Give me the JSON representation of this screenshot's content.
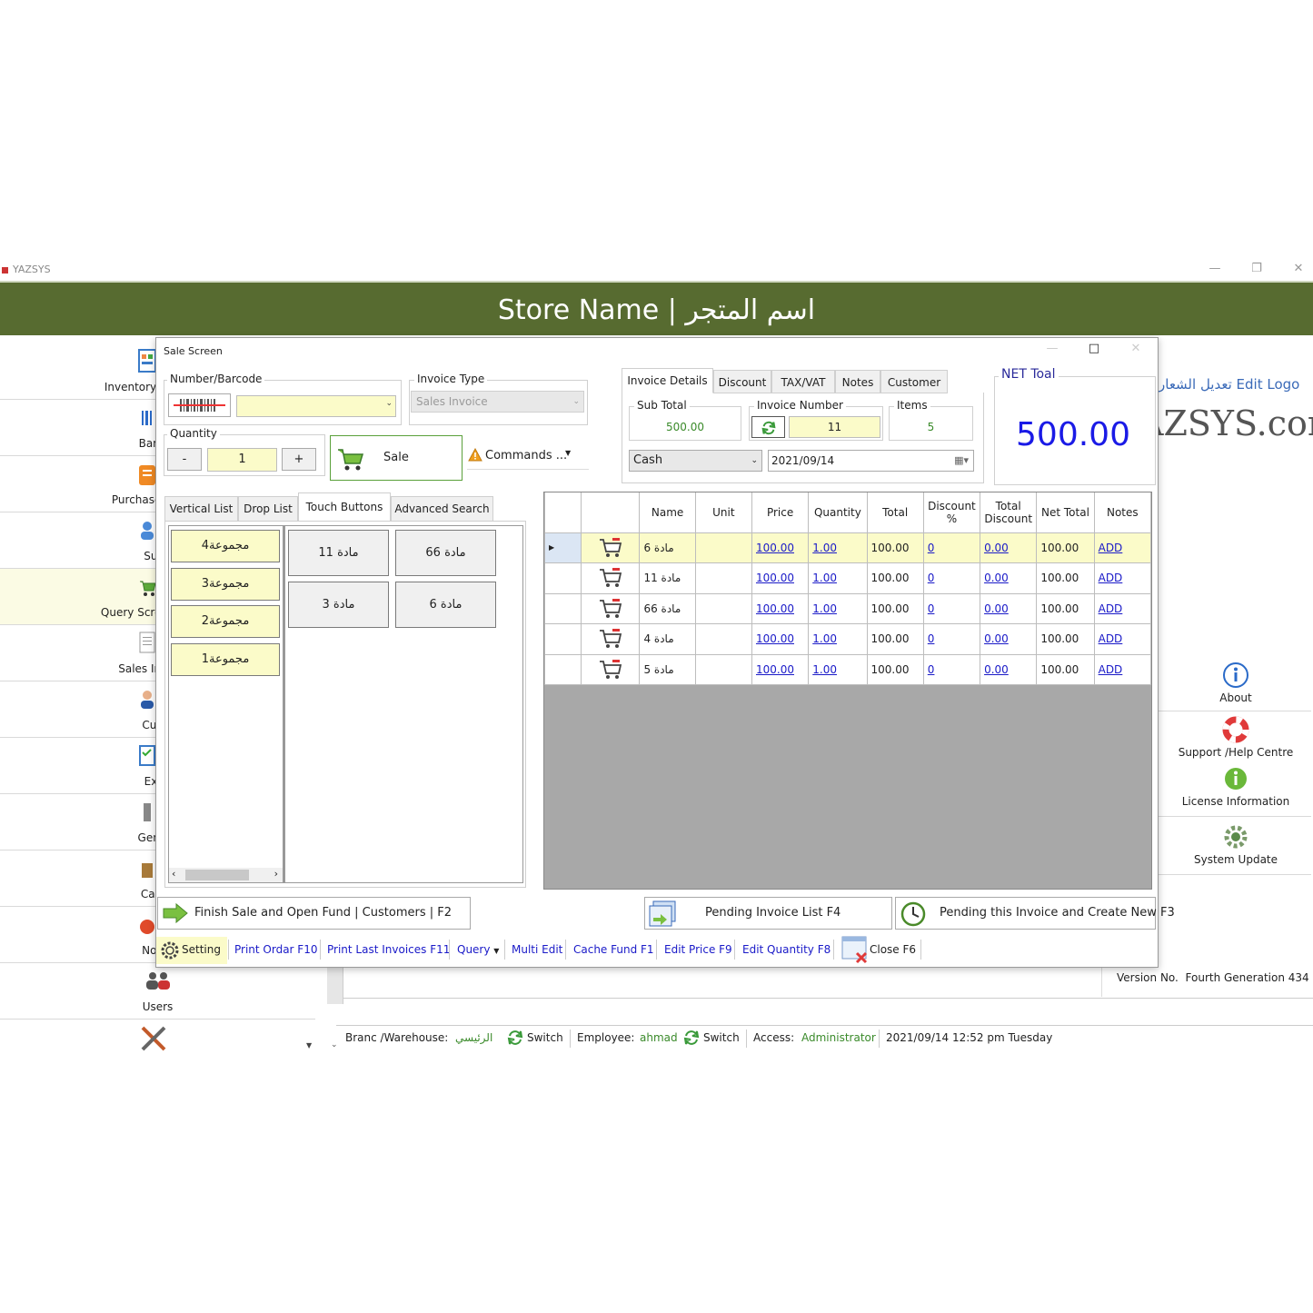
{
  "app": {
    "title": "YAZSYS",
    "banner": "Store Name | اسم المتجر"
  },
  "sidebar": {
    "items": [
      {
        "label": "Inventory and Mate"
      },
      {
        "label": "Barcod"
      },
      {
        "label": "Purchase Invoice"
      },
      {
        "label": "Supp"
      },
      {
        "label": "Query Screen | Sales"
      },
      {
        "label": "Sales Invoice |"
      },
      {
        "label": "Custo"
      },
      {
        "label": "Expe"
      },
      {
        "label": "Genera"
      },
      {
        "label": "Cache"
      },
      {
        "label": "Notes"
      },
      {
        "label": "Users"
      }
    ]
  },
  "right_panel": {
    "edit_logo": "تعديل الشعار Edit Logo",
    "brand": "AZSYS.com",
    "about": "About",
    "support": "Support /Help Centre",
    "license": "License Information",
    "update": "System Update",
    "version_label": "Version No.",
    "version_value": "Fourth Generation 434"
  },
  "status": {
    "branch_label": "Branc /Warehouse:",
    "branch_value": "الرئيسي",
    "switch1": "Switch",
    "employee_label": "Employee:",
    "employee_value": "ahmad",
    "switch2": "Switch",
    "access_label": "Access:",
    "access_value": "Administrator",
    "datetime": "2021/09/14 12:52 pm Tuesday"
  },
  "dialog": {
    "title": "Sale Screen",
    "number_barcode_label": "Number/Barcode",
    "invoice_type_label": "Invoice Type",
    "invoice_type_value": "Sales Invoice",
    "quantity_label": "Quantity",
    "quantity_value": "1",
    "minus": "-",
    "plus": "+",
    "sale_button": "Sale",
    "commands_button": "Commands ...",
    "details_tabs": [
      "Invoice Details",
      "Discount",
      "TAX/VAT",
      "Notes",
      "Customer"
    ],
    "sub_total_label": "Sub Total",
    "sub_total_value": "500.00",
    "invoice_number_label": "Invoice Number",
    "invoice_number_value": "11",
    "items_label": "Items",
    "items_value": "5",
    "payment_method": "Cash",
    "invoice_date": "2021/09/14",
    "net_total_label": "NET Toal",
    "net_total_value": "500.00",
    "item_tabs": [
      "Vertical List",
      "Drop List",
      "Touch Buttons",
      "Advanced Search"
    ],
    "groups": [
      "مجموعة4",
      "مجموعة3",
      "مجموعة2",
      "مجموعة1"
    ],
    "touch_items": [
      "مادة 11",
      "مادة 66",
      "مادة 3",
      "مادة 6"
    ],
    "grid": {
      "columns": [
        "",
        "",
        "Name",
        "Unit",
        "Price",
        "Quantity",
        "Total",
        "Discount %",
        "Total Discount",
        "Net Total",
        "Notes"
      ],
      "rows": [
        {
          "name": "مادة 6",
          "unit": "",
          "price": "100.00",
          "qty": "1.00",
          "total": "100.00",
          "disc": "0",
          "tdisc": "0.00",
          "net": "100.00",
          "notes": "ADD"
        },
        {
          "name": "مادة 11",
          "unit": "",
          "price": "100.00",
          "qty": "1.00",
          "total": "100.00",
          "disc": "0",
          "tdisc": "0.00",
          "net": "100.00",
          "notes": "ADD"
        },
        {
          "name": "مادة 66",
          "unit": "",
          "price": "100.00",
          "qty": "1.00",
          "total": "100.00",
          "disc": "0",
          "tdisc": "0.00",
          "net": "100.00",
          "notes": "ADD"
        },
        {
          "name": "مادة 4",
          "unit": "",
          "price": "100.00",
          "qty": "1.00",
          "total": "100.00",
          "disc": "0",
          "tdisc": "0.00",
          "net": "100.00",
          "notes": "ADD"
        },
        {
          "name": "مادة 5",
          "unit": "",
          "price": "100.00",
          "qty": "1.00",
          "total": "100.00",
          "disc": "0",
          "tdisc": "0.00",
          "net": "100.00",
          "notes": "ADD"
        }
      ]
    },
    "finish_button": "Finish Sale and Open Fund | Customers | F2",
    "pending_list_button": "Pending  Invoice List F4",
    "pending_create_button": "Pending this Invoice and Create New F3",
    "toolbar": {
      "setting": "Setting",
      "print_order": "Print Ordar F10",
      "print_last": "Print Last Invoices F11",
      "query": "Query",
      "multi_edit": "Multi Edit",
      "cache_fund": "Cache Fund F1",
      "edit_price": "Edit Price F9",
      "edit_quantity": "Edit Quantity F8",
      "close": "Close F6"
    }
  },
  "colors": {
    "banner": "#576b30",
    "field_yellow": "#fbfbc9",
    "net_total": "#1a1ae6",
    "link": "#1a1ac8"
  }
}
